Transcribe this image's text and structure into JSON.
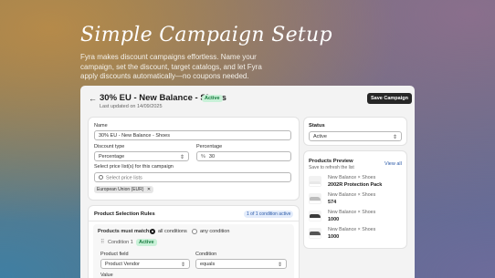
{
  "hero": {
    "title": "Simple Campaign Setup",
    "description": "Fyra makes discount campaigns effortless. Name your campaign, set the discount, target catalogs, and let Fyra apply discounts automatically—no coupons needed."
  },
  "header": {
    "back_icon": "arrow-left-icon",
    "title": "30% EU - New Balance - Shoes",
    "status_badge": "Active",
    "updated": "Last updated on 14/09/2025",
    "save_label": "Save Campaign"
  },
  "form": {
    "name_label": "Name",
    "name_value": "30% EU - New Balance - Shoes",
    "discount_type_label": "Discount type",
    "discount_type_value": "Percentage",
    "percentage_label": "Percentage",
    "percentage_prefix": "%",
    "percentage_value": "30",
    "price_list_label": "Select price list(s) for this campaign",
    "price_list_placeholder": "Select price lists",
    "selected_price_list": "European Union (EUR)",
    "remove_icon": "close-icon"
  },
  "rules": {
    "title": "Product Selection Rules",
    "count_badge": "1 of 1 condition active",
    "must_match_label": "Products must match:",
    "all_label": "all conditions",
    "any_label": "any condition",
    "condition_label": "Condition 1",
    "condition_badge": "Active",
    "product_field_label": "Product field",
    "product_field_value": "Product Vendor",
    "condition_field_label": "Condition",
    "condition_value": "equals",
    "value_label": "Value"
  },
  "status": {
    "label": "Status",
    "value": "Active"
  },
  "preview": {
    "title": "Products Preview",
    "subtitle": "Save to refresh the list",
    "view_all": "View all",
    "items": [
      {
        "vendor": "New Balance × Shoes",
        "name": "2002R Protection Pack"
      },
      {
        "vendor": "New Balance × Shoes",
        "name": "574"
      },
      {
        "vendor": "New Balance × Shoes",
        "name": "1000"
      },
      {
        "vendor": "New Balance × Shoes",
        "name": "1000"
      }
    ]
  },
  "colors": {
    "accent_dark": "#262626",
    "active_green": "#167a3e",
    "info_blue": "#2b5aa8"
  }
}
